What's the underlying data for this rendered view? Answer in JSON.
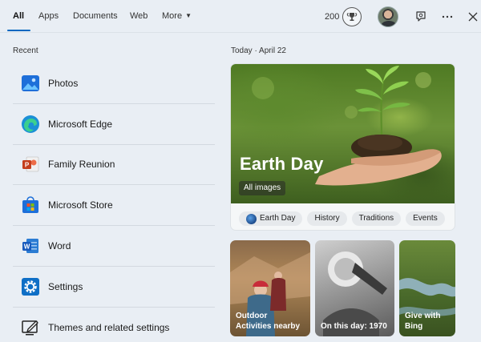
{
  "tabs": [
    {
      "label": "All",
      "active": true
    },
    {
      "label": "Apps"
    },
    {
      "label": "Documents"
    },
    {
      "label": "Web"
    },
    {
      "label": "More"
    }
  ],
  "header": {
    "points": "200",
    "trophy_icon": "trophy-icon",
    "feedback_icon": "feedback-icon",
    "more_icon": "ellipsis-icon",
    "close_icon": "close-icon"
  },
  "recent": {
    "label": "Recent",
    "items": [
      {
        "label": "Photos",
        "icon": "photos-icon"
      },
      {
        "label": "Microsoft Edge",
        "icon": "edge-icon"
      },
      {
        "label": "Family Reunion",
        "icon": "powerpoint-icon"
      },
      {
        "label": "Microsoft Store",
        "icon": "store-icon"
      },
      {
        "label": "Word",
        "icon": "word-icon"
      },
      {
        "label": "Settings",
        "icon": "settings-icon"
      },
      {
        "label": "Themes and related settings",
        "icon": "themes-icon"
      }
    ]
  },
  "today": {
    "label": "Today",
    "separator": "·",
    "date": "April 22",
    "hero_title": "Earth Day",
    "hero_button": "All images",
    "chips": [
      "Earth Day",
      "History",
      "Traditions",
      "Events"
    ]
  },
  "cards": [
    {
      "line1": "Outdoor",
      "line2": "Activities nearby"
    },
    {
      "line1": "On this day: 1970",
      "line2": ""
    },
    {
      "line1": "Give with Bing",
      "line2": ""
    }
  ],
  "colors": {
    "accent": "#0067c0",
    "background": "#e9eef4"
  }
}
